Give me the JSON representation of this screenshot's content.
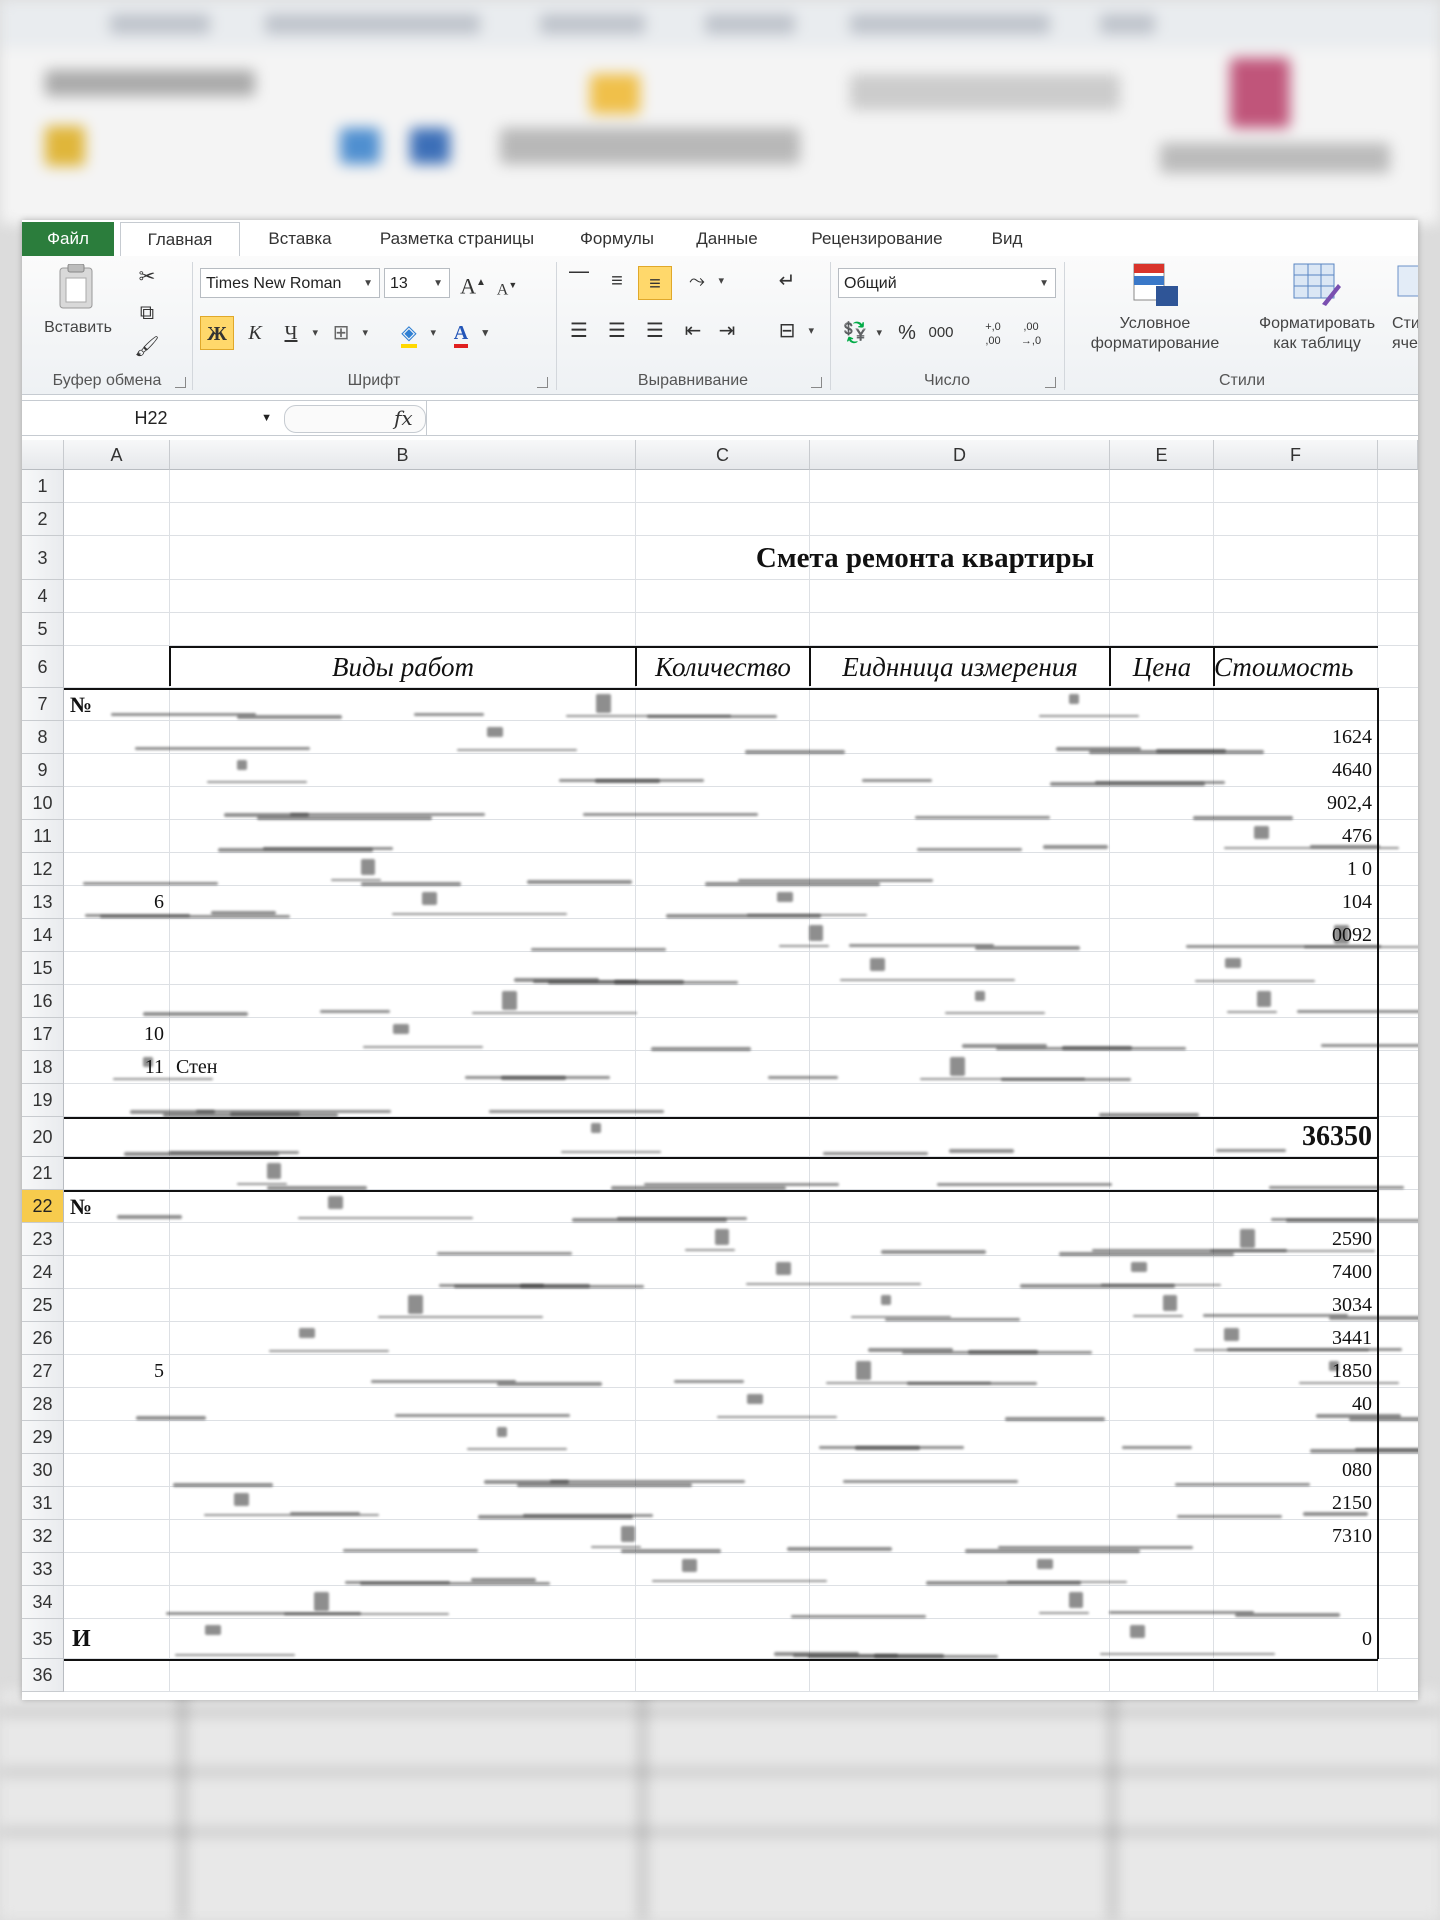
{
  "ribbon_tabs": {
    "file": "Файл",
    "items": [
      "Главная",
      "Вставка",
      "Разметка страницы",
      "Формулы",
      "Данные",
      "Рецензирование",
      "Вид"
    ]
  },
  "ribbon": {
    "clipboard": {
      "paste": "Вставить",
      "group": "Буфер обмена"
    },
    "font": {
      "name": "Times New Roman",
      "size": "13",
      "bold": "Ж",
      "italic": "К",
      "underline": "Ч",
      "grow": "A",
      "shrink": "A",
      "color_glyph": "A",
      "group": "Шрифт"
    },
    "alignment": {
      "group": "Выравнивание"
    },
    "number": {
      "format": "Общий",
      "percent": "%",
      "thousands": "000",
      "inc": "+,0\n,00",
      "dec": ",00\n→,0",
      "group": "Число"
    },
    "styles": {
      "conditional": [
        "Условное",
        "форматирование"
      ],
      "as_table": [
        "Форматировать",
        "как таблицу"
      ],
      "cell_styles": [
        "Сти",
        "ячее"
      ],
      "group": "Стили"
    }
  },
  "formula_bar": {
    "name_box": "H22",
    "fx": "fx",
    "value": ""
  },
  "columns": [
    "A",
    "B",
    "C",
    "D",
    "E",
    "F"
  ],
  "rows": [
    "1",
    "2",
    "3",
    "4",
    "5",
    "6",
    "7",
    "8",
    "9",
    "10",
    "11",
    "12",
    "13",
    "14",
    "15",
    "16",
    "17",
    "18",
    "19",
    "20",
    "21",
    "22",
    "23",
    "24",
    "25",
    "26",
    "27",
    "28",
    "29",
    "30",
    "31",
    "32",
    "33",
    "34",
    "35",
    "36"
  ],
  "selected_row": "22",
  "sheet": {
    "title": "Смета ремонта квартиры",
    "headers": [
      "Виды работ",
      "Количество",
      "Еиднница измерения",
      "Цена",
      "Стоимость"
    ],
    "no_label": "№",
    "col_a": [
      {
        "row": 13,
        "text": "6"
      },
      {
        "row": 17,
        "text": "10"
      },
      {
        "row": 18,
        "text": "11"
      },
      {
        "row": 27,
        "text": "5"
      }
    ],
    "b18": "Стен",
    "f_values": [
      {
        "row": 8,
        "text": "1624"
      },
      {
        "row": 9,
        "text": "4640"
      },
      {
        "row": 10,
        "text": "902,4"
      },
      {
        "row": 11,
        "text": "476"
      },
      {
        "row": 12,
        "text": "1 0"
      },
      {
        "row": 13,
        "text": "104"
      },
      {
        "row": 14,
        "text": "0092"
      },
      {
        "row": 23,
        "text": "2590"
      },
      {
        "row": 24,
        "text": "7400"
      },
      {
        "row": 25,
        "text": "3034"
      },
      {
        "row": 26,
        "text": "3441"
      },
      {
        "row": 27,
        "text": "1850"
      },
      {
        "row": 28,
        "text": "40"
      },
      {
        "row": 30,
        "text": "080"
      },
      {
        "row": 31,
        "text": "2150"
      },
      {
        "row": 32,
        "text": "7310"
      },
      {
        "row": 35,
        "text": "0"
      }
    ],
    "total_20": "36350",
    "row35_label": "И"
  }
}
